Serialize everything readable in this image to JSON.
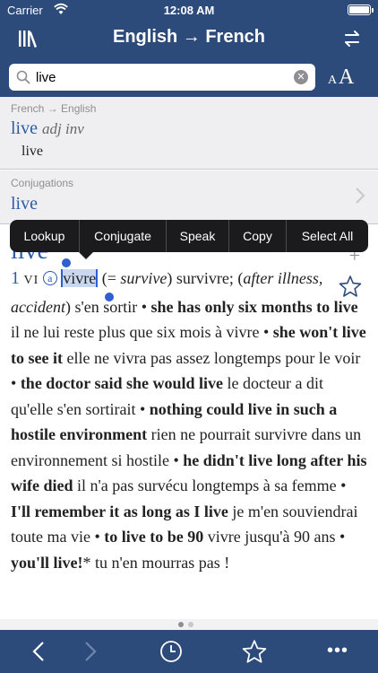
{
  "status": {
    "carrier": "Carrier",
    "time": "12:08 AM"
  },
  "nav": {
    "title": "English → French"
  },
  "search": {
    "value": "live"
  },
  "font_size": {
    "small": "A",
    "large": "A"
  },
  "results": [
    {
      "category": "French → English",
      "headword": "live",
      "pos": "adj inv",
      "translation": "live"
    },
    {
      "category": "Conjugations",
      "headword": "live"
    }
  ],
  "context_menu": {
    "items": [
      "Lookup",
      "Conjugate",
      "Speak",
      "Copy",
      "Select All"
    ]
  },
  "entry": {
    "headword": "live",
    "sense_number": "1",
    "pos": "VI",
    "marker": "a",
    "selected_word": "vivre",
    "segments": [
      {
        "text": " (= ",
        "style": ""
      },
      {
        "text": "survive",
        "style": "it"
      },
      {
        "text": ") survivre; (",
        "style": ""
      },
      {
        "text": "after illness, accident",
        "style": "it"
      },
      {
        "text": ") s'en sortir • ",
        "style": ""
      },
      {
        "text": "she has only six months to live",
        "style": "b"
      },
      {
        "text": " il ne lui reste plus que six mois à vivre • ",
        "style": ""
      },
      {
        "text": "she won't live to see it",
        "style": "b"
      },
      {
        "text": " elle ne vivra pas assez longtemps pour le voir • ",
        "style": ""
      },
      {
        "text": "the doctor said she would live",
        "style": "b"
      },
      {
        "text": " le docteur a dit qu'elle s'en sortirait • ",
        "style": ""
      },
      {
        "text": "nothing could live in such a hostile environment",
        "style": "b"
      },
      {
        "text": " rien ne pourrait survivre dans un environnement si hostile • ",
        "style": ""
      },
      {
        "text": "he didn't live long after his wife died",
        "style": "b"
      },
      {
        "text": " il n'a pas survécu longtemps à sa femme • ",
        "style": ""
      },
      {
        "text": "I'll remember it as long as I live",
        "style": "b"
      },
      {
        "text": " je m'en souviendrai toute ma vie • ",
        "style": ""
      },
      {
        "text": "to live to be 90",
        "style": "b"
      },
      {
        "text": " vivre jusqu'à 90 ans • ",
        "style": ""
      },
      {
        "text": "you'll live!",
        "style": "b"
      },
      {
        "text": "*",
        "style": ""
      },
      {
        "text": " tu n'en mourras pas !",
        "style": ""
      }
    ]
  },
  "page_dots": {
    "count": 2,
    "active": 0,
    "active_color": "#8e8e93",
    "inactive_color": "#c7c7cc"
  },
  "colors": {
    "bar": "#2c4a7a",
    "link": "#2c5ba8",
    "selection": "#2f5fd0"
  }
}
